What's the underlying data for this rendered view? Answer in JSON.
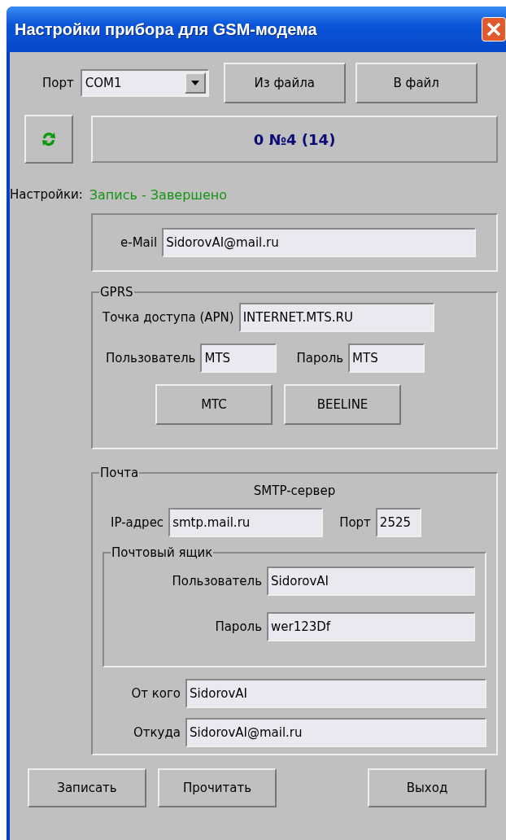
{
  "window": {
    "title": "Настройки прибора для GSM-модема"
  },
  "port": {
    "label": "Порт",
    "value": "COM1"
  },
  "file_buttons": [
    "Из файла",
    "В файл"
  ],
  "device_display": "0 №4 (14)",
  "status": {
    "label": "Настройки:",
    "value": "Запись - Завершено"
  },
  "email": {
    "label": "e-Mail",
    "value": "SidorovAI@mail.ru"
  },
  "gprs": {
    "title": "GPRS",
    "apn": {
      "label": "Точка доступа (APN)",
      "value": "INTERNET.MTS.RU"
    },
    "user": {
      "label": "Пользователь",
      "value": "MTS"
    },
    "password": {
      "label": "Пароль",
      "value": "MTS"
    },
    "buttons": [
      "MTC",
      "BEELINE"
    ]
  },
  "mail": {
    "title": "Почта",
    "smtp_title": "SMTP-сервер",
    "ip": {
      "label": "IP-адрес",
      "value": "smtp.mail.ru"
    },
    "port": {
      "label": "Порт",
      "value": "2525"
    },
    "mailbox": {
      "title": "Почтовый ящик",
      "user": {
        "label": "Пользователь",
        "value": "SidorovAI"
      },
      "password": {
        "label": "Пароль",
        "value": "wer123Df"
      }
    },
    "from": {
      "label": "От кого",
      "value": "SidorovAI"
    },
    "origin": {
      "label": "Откуда",
      "value": "SidorovAI@mail.ru"
    }
  },
  "footer_buttons": [
    "Записать",
    "Прочитать",
    "Выход"
  ]
}
